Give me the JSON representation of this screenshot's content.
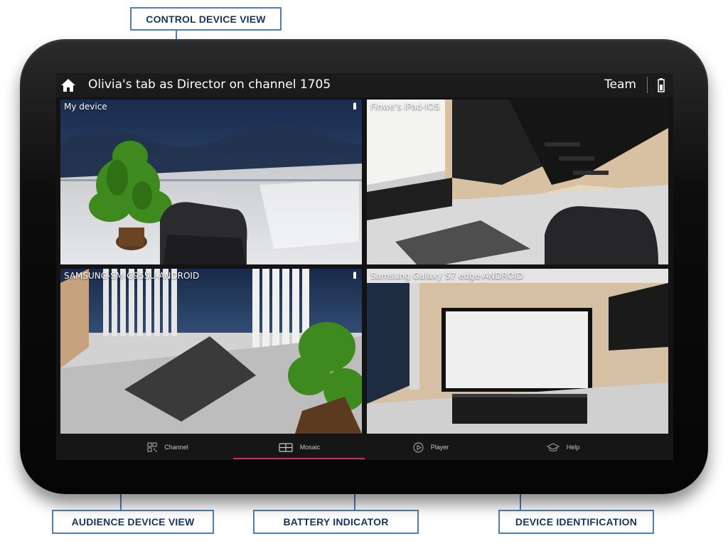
{
  "callouts": {
    "control_device_view": "CONTROL DEVICE VIEW",
    "audience_device_view": "AUDIENCE DEVICE VIEW",
    "battery_indicator": "BATTERY INDICATOR",
    "device_identification": "DEVICE IDENTIFICATION"
  },
  "header": {
    "home_icon": "home-icon",
    "title": "Olivia's tab as Director on channel 1705",
    "team_label": "Team",
    "battery_icon": "battery-icon"
  },
  "tiles": [
    {
      "label": "My device",
      "battery_shown": true
    },
    {
      "label": "Finwe's iPad-IOS",
      "battery_shown": false
    },
    {
      "label": "SAMSUNG-SM-G955U-ANDROID",
      "battery_shown": true
    },
    {
      "label": "Samsung Galaxy S7 edge-ANDROID",
      "battery_shown": false
    }
  ],
  "nav": {
    "items": [
      {
        "label": "Channel",
        "icon": "qr-code-icon",
        "active": false
      },
      {
        "label": "Mosaic",
        "icon": "mosaic-icon",
        "active": true
      },
      {
        "label": "Player",
        "icon": "play-icon",
        "active": false
      },
      {
        "label": "Help",
        "icon": "graduation-cap-icon",
        "active": false
      }
    ]
  },
  "colors": {
    "callout_border": "#4f7fb8",
    "callout_text": "#17365d",
    "active_tab_underline": "#d02a5c",
    "screen_background": "#131313"
  }
}
